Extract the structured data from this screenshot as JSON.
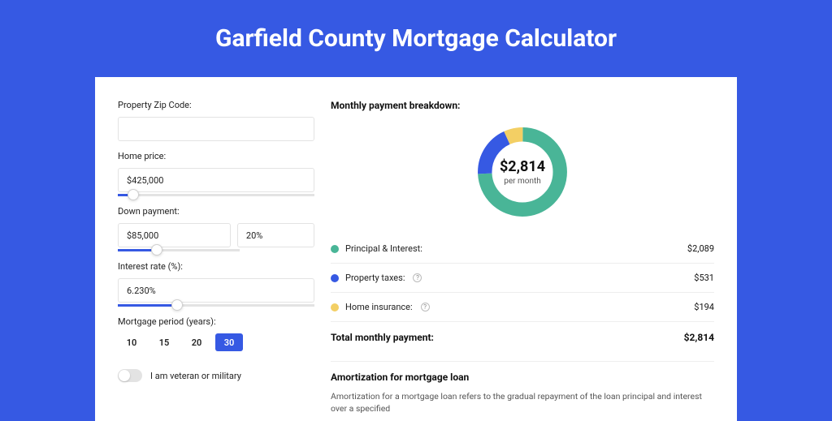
{
  "title": "Garfield County Mortgage Calculator",
  "left": {
    "zip_label": "Property Zip Code:",
    "zip_value": "",
    "home_price_label": "Home price:",
    "home_price_value": "$425,000",
    "home_price_slider_pct": 8,
    "down_label": "Down payment:",
    "down_value": "$85,000",
    "down_pct_value": "20%",
    "down_slider_pct": 20,
    "rate_label": "Interest rate (%):",
    "rate_value": "6.230%",
    "rate_slider_pct": 30,
    "period_label": "Mortgage period (years):",
    "periods": [
      "10",
      "15",
      "20",
      "30"
    ],
    "period_active": "30",
    "vet_label": "I am veteran or military"
  },
  "right": {
    "breakdown_title": "Monthly payment breakdown:",
    "donut_value": "$2,814",
    "donut_sub": "per month",
    "items": [
      {
        "label": "Principal & Interest:",
        "value": "$2,089",
        "color": "#49b597",
        "info": false
      },
      {
        "label": "Property taxes:",
        "value": "$531",
        "color": "#3659e3",
        "info": true
      },
      {
        "label": "Home insurance:",
        "value": "$194",
        "color": "#f3cf64",
        "info": true
      }
    ],
    "total_label": "Total monthly payment:",
    "total_value": "$2,814",
    "amort_title": "Amortization for mortgage loan",
    "amort_text": "Amortization for a mortgage loan refers to the gradual repayment of the loan principal and interest over a specified"
  },
  "chart_data": {
    "type": "pie",
    "title": "Monthly payment breakdown",
    "series": [
      {
        "name": "Principal & Interest",
        "value": 2089,
        "color": "#49b597"
      },
      {
        "name": "Property taxes",
        "value": 531,
        "color": "#3659e3"
      },
      {
        "name": "Home insurance",
        "value": 194,
        "color": "#f3cf64"
      }
    ],
    "total": 2814,
    "center_label": "$2,814 per month"
  }
}
